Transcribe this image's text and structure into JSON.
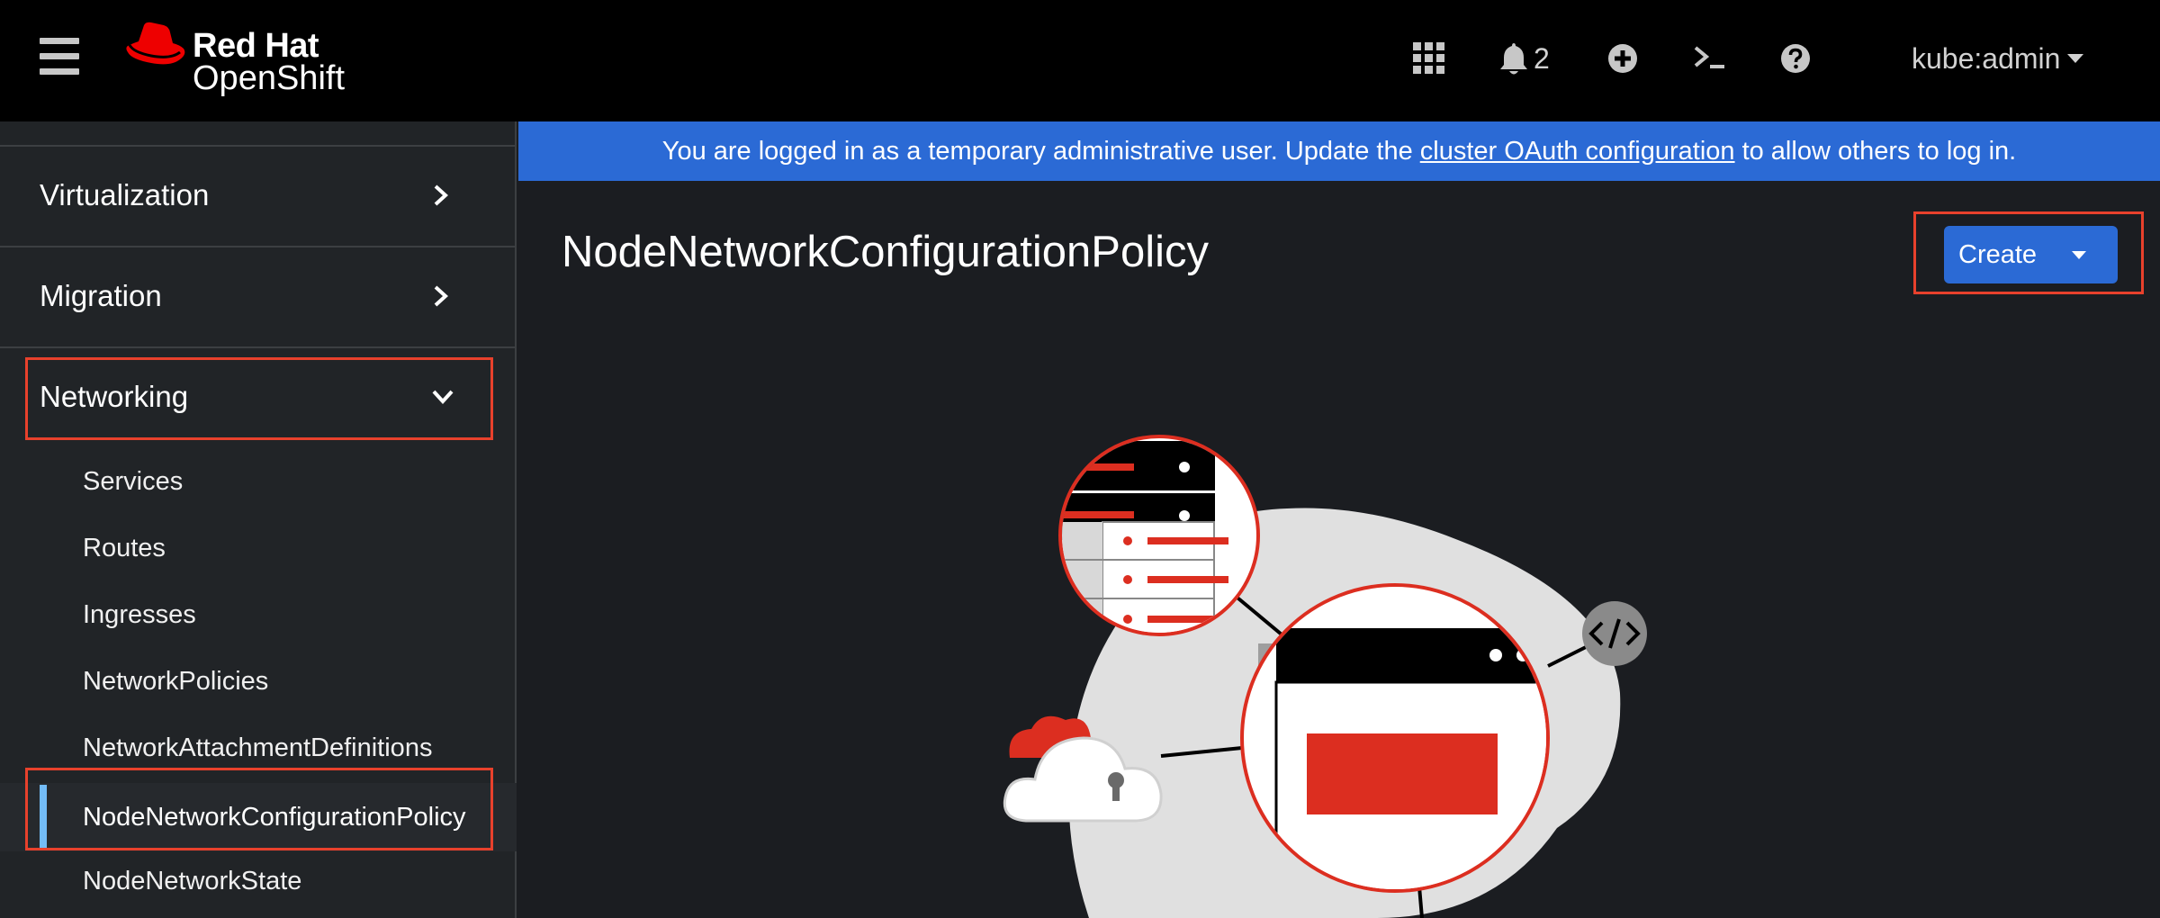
{
  "masthead": {
    "brand_line1": "Red Hat",
    "brand_line2": "OpenShift",
    "notification_count": "2",
    "user_name": "kube:admin",
    "icons": [
      "menu-icon",
      "app-launcher-icon",
      "bell-icon",
      "plus-circle-icon",
      "terminal-icon",
      "help-icon"
    ]
  },
  "sidebar": {
    "sections": [
      {
        "label": "Virtualization",
        "expanded": false
      },
      {
        "label": "Migration",
        "expanded": false
      },
      {
        "label": "Networking",
        "expanded": true
      }
    ],
    "networking_items": [
      {
        "label": "Services"
      },
      {
        "label": "Routes"
      },
      {
        "label": "Ingresses"
      },
      {
        "label": "NetworkPolicies"
      },
      {
        "label": "NetworkAttachmentDefinitions"
      },
      {
        "label": "NodeNetworkConfigurationPolicy",
        "active": true
      },
      {
        "label": "NodeNetworkState"
      }
    ]
  },
  "banner": {
    "text_before": "You are logged in as a temporary administrative user. Update the",
    "link_text": "cluster OAuth configuration",
    "text_after": "to allow others to log in."
  },
  "main": {
    "title": "NodeNetworkConfigurationPolicy",
    "create_button_label": "Create"
  },
  "colors": {
    "masthead_bg": "#000000",
    "sidebar_bg": "#212427",
    "main_bg": "#1b1d21",
    "banner_bg": "#2b6ad5",
    "primary_button": "#2b6ad5",
    "active_nav_bar": "#73bcf7",
    "highlight_outline": "#e8412c",
    "illustration_red": "#dc2e20"
  }
}
